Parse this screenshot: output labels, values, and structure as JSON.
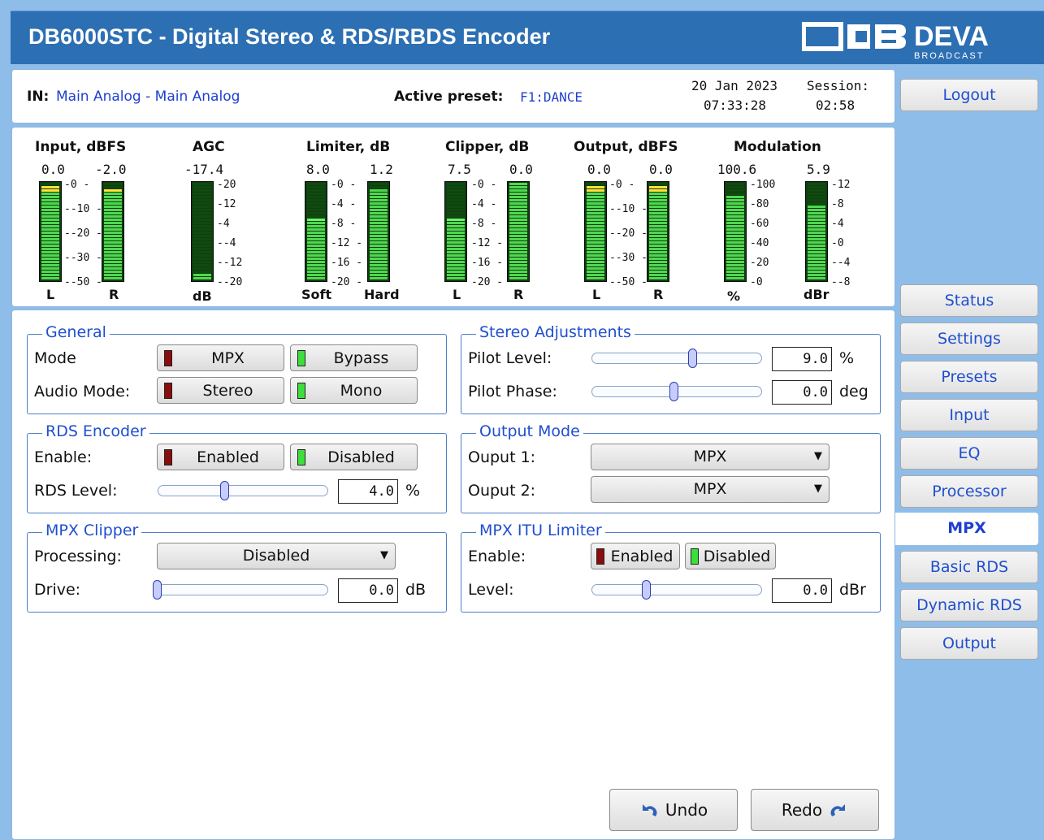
{
  "header": {
    "title": "DB6000STC - Digital Stereo & RDS/RBDS Encoder",
    "logo_main": "DEVA",
    "logo_sub": "BROADCAST"
  },
  "info": {
    "in_label": "IN:",
    "in_value": "Main Analog - Main Analog",
    "preset_label": "Active preset:",
    "preset_value": "F1:DANCE",
    "date": "20 Jan 2023",
    "time": "07:33:28",
    "session_label": "Session:",
    "session_value": "02:58"
  },
  "meters": {
    "input": {
      "title": "Input, dBFS",
      "left_value": "0.0",
      "right_value": "-2.0",
      "scale": [
        "0",
        "-10",
        "-20",
        "-30",
        "-50"
      ],
      "left_label": "L",
      "right_label": "R",
      "left_level": 0.98,
      "right_level": 0.94
    },
    "agc": {
      "title": "AGC",
      "value": "-17.4",
      "scale": [
        "20",
        "12",
        "4",
        "-4",
        "-12",
        "-20"
      ],
      "bottom_label": "dB",
      "level": 0.08
    },
    "limiter": {
      "title": "Limiter, dB",
      "left_value": "8.0",
      "right_value": "1.2",
      "scale": [
        "0",
        "4",
        "8",
        "12",
        "16",
        "20"
      ],
      "left_label": "Soft",
      "right_label": "Hard",
      "left_level": 0.62,
      "right_level": 0.94
    },
    "clipper": {
      "title": "Clipper, dB",
      "left_value": "7.5",
      "right_value": "0.0",
      "scale": [
        "0",
        "4",
        "8",
        "12",
        "16",
        "20"
      ],
      "left_label": "L",
      "right_label": "R",
      "left_level": 0.62,
      "right_level": 1.0
    },
    "output": {
      "title": "Output, dBFS",
      "left_value": "0.0",
      "right_value": "0.0",
      "scale": [
        "0",
        "-10",
        "-20",
        "-30",
        "-50"
      ],
      "left_label": "L",
      "right_label": "R",
      "left_level": 0.98,
      "right_level": 0.98
    },
    "modulation": {
      "title": "Modulation",
      "left_value": "100.6",
      "right_value": "5.9",
      "left_scale": [
        "100",
        "80",
        "60",
        "40",
        "20",
        "0"
      ],
      "right_scale": [
        "12",
        "8",
        "4",
        "0",
        "-4",
        "-8"
      ],
      "left_label": "%",
      "right_label": "dBr",
      "left_level": 0.88,
      "right_level": 0.78
    }
  },
  "general": {
    "legend": "General",
    "mode_label": "Mode",
    "mode_opt1": "MPX",
    "mode_opt2": "Bypass",
    "audio_label": "Audio Mode:",
    "audio_opt1": "Stereo",
    "audio_opt2": "Mono"
  },
  "stereo": {
    "legend": "Stereo Adjustments",
    "pilot_level_label": "Pilot Level:",
    "pilot_level_value": "9.0",
    "pilot_level_unit": "%",
    "pilot_phase_label": "Pilot Phase:",
    "pilot_phase_value": "0.0",
    "pilot_phase_unit": "deg"
  },
  "rds": {
    "legend": "RDS Encoder",
    "enable_label": "Enable:",
    "opt1": "Enabled",
    "opt2": "Disabled",
    "level_label": "RDS Level:",
    "level_value": "4.0",
    "level_unit": "%"
  },
  "output_mode": {
    "legend": "Output Mode",
    "out1_label": "Ouput 1:",
    "out1_value": "MPX",
    "out2_label": "Ouput 2:",
    "out2_value": "MPX"
  },
  "clipper": {
    "legend": "MPX Clipper",
    "processing_label": "Processing:",
    "processing_value": "Disabled",
    "drive_label": "Drive:",
    "drive_value": "0.0",
    "drive_unit": "dB"
  },
  "itu": {
    "legend": "MPX ITU Limiter",
    "enable_label": "Enable:",
    "opt1": "Enabled",
    "opt2": "Disabled",
    "level_label": "Level:",
    "level_value": "0.0",
    "level_unit": "dBr"
  },
  "actions": {
    "undo": "Undo",
    "redo": "Redo"
  },
  "nav": {
    "logout": "Logout",
    "items": [
      "Status",
      "Settings",
      "Presets",
      "Input",
      "EQ",
      "Processor",
      "MPX",
      "Basic RDS",
      "Dynamic RDS",
      "Output"
    ],
    "active": "MPX"
  },
  "colors": {
    "header": "#2d6fb3",
    "background": "#8fbde9",
    "accent": "#1f4fd0",
    "led_red": "#8a0c0c",
    "led_green": "#3be03b"
  }
}
